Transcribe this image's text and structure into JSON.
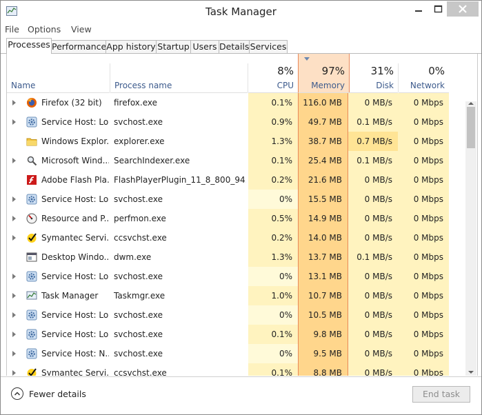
{
  "window": {
    "title": "Task Manager"
  },
  "menu": [
    "File",
    "Options",
    "View"
  ],
  "tabs": [
    "Processes",
    "Performance",
    "App history",
    "Startup",
    "Users",
    "Details",
    "Services"
  ],
  "active_tab": "Processes",
  "columns": {
    "name": "Name",
    "process": "Process name",
    "cpu": {
      "pct": "8%",
      "label": "CPU"
    },
    "memory": {
      "pct": "97%",
      "label": "Memory"
    },
    "disk": {
      "pct": "31%",
      "label": "Disk"
    },
    "network": {
      "pct": "0%",
      "label": "Network"
    }
  },
  "sort_column": "memory",
  "colors": {
    "cpu_cell": "#fff3bf",
    "cpu_cell_low": "#fffad9",
    "memory_cell": "#ffd68c",
    "memory_border": "#e8895a",
    "memory_header": "#fde0c5",
    "disk_cell": "#fff3bf",
    "disk_cell_hot": "#ffe495",
    "network_cell": "#fff3bf"
  },
  "rows": [
    {
      "name": "Firefox (32 bit)",
      "process": "firefox.exe",
      "cpu": "0.1%",
      "memory": "116.0 MB",
      "disk": "0 MB/s",
      "network": "0 Mbps",
      "icon": "firefox-icon",
      "expand": true
    },
    {
      "name": "Service Host: Lo...",
      "process": "svchost.exe",
      "cpu": "0.9%",
      "memory": "49.7 MB",
      "disk": "0.1 MB/s",
      "network": "0 Mbps",
      "icon": "gear-icon",
      "expand": true
    },
    {
      "name": "Windows Explor...",
      "process": "explorer.exe",
      "cpu": "1.3%",
      "memory": "38.7 MB",
      "disk": "0.7 MB/s",
      "network": "0 Mbps",
      "icon": "folder-icon",
      "expand": false
    },
    {
      "name": "Microsoft Wind...",
      "process": "SearchIndexer.exe",
      "cpu": "0.1%",
      "memory": "25.4 MB",
      "disk": "0.1 MB/s",
      "network": "0 Mbps",
      "icon": "search-indexer-icon",
      "expand": true
    },
    {
      "name": "Adobe Flash Pla...",
      "process": "FlashPlayerPlugin_11_8_800_94.exe",
      "cpu": "0.2%",
      "memory": "21.6 MB",
      "disk": "0 MB/s",
      "network": "0 Mbps",
      "icon": "flash-icon",
      "expand": false
    },
    {
      "name": "Service Host: Lo...",
      "process": "svchost.exe",
      "cpu": "0%",
      "memory": "15.5 MB",
      "disk": "0 MB/s",
      "network": "0 Mbps",
      "icon": "gear-icon",
      "expand": true
    },
    {
      "name": "Resource and P...",
      "process": "perfmon.exe",
      "cpu": "0.5%",
      "memory": "14.9 MB",
      "disk": "0 MB/s",
      "network": "0 Mbps",
      "icon": "gauge-icon",
      "expand": true
    },
    {
      "name": "Symantec Servi...",
      "process": "ccsvchst.exe",
      "cpu": "0.2%",
      "memory": "14.0 MB",
      "disk": "0 MB/s",
      "network": "0 Mbps",
      "icon": "checkmark-icon",
      "expand": true
    },
    {
      "name": "Desktop Windo...",
      "process": "dwm.exe",
      "cpu": "1.3%",
      "memory": "13.7 MB",
      "disk": "0.1 MB/s",
      "network": "0 Mbps",
      "icon": "window-icon",
      "expand": false
    },
    {
      "name": "Service Host: Lo...",
      "process": "svchost.exe",
      "cpu": "0%",
      "memory": "13.1 MB",
      "disk": "0 MB/s",
      "network": "0 Mbps",
      "icon": "gear-icon",
      "expand": true
    },
    {
      "name": "Task Manager",
      "process": "Taskmgr.exe",
      "cpu": "1.0%",
      "memory": "10.7 MB",
      "disk": "0 MB/s",
      "network": "0 Mbps",
      "icon": "task-manager-icon",
      "expand": true
    },
    {
      "name": "Service Host: Lo...",
      "process": "svchost.exe",
      "cpu": "0%",
      "memory": "10.5 MB",
      "disk": "0 MB/s",
      "network": "0 Mbps",
      "icon": "gear-icon",
      "expand": true
    },
    {
      "name": "Service Host: Lo...",
      "process": "svchost.exe",
      "cpu": "0.1%",
      "memory": "9.8 MB",
      "disk": "0 MB/s",
      "network": "0 Mbps",
      "icon": "gear-icon",
      "expand": true
    },
    {
      "name": "Service Host: N...",
      "process": "svchost.exe",
      "cpu": "0%",
      "memory": "9.5 MB",
      "disk": "0 MB/s",
      "network": "0 Mbps",
      "icon": "gear-icon",
      "expand": true
    },
    {
      "name": "Symantec Servi...",
      "process": "ccsvchst.exe",
      "cpu": "0.1%",
      "memory": "8.8 MB",
      "disk": "0 MB/s",
      "network": "0 Mbps",
      "icon": "checkmark-icon",
      "expand": true
    }
  ],
  "footer": {
    "fewer_details": "Fewer details",
    "end_task": "End task"
  }
}
